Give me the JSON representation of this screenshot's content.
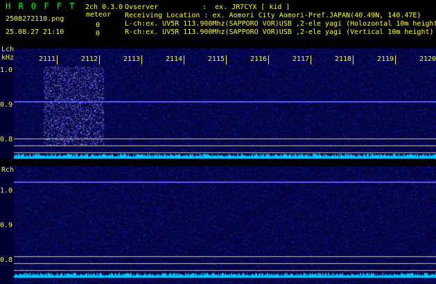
{
  "header": {
    "app_name": "H R O F F T",
    "version": "2ch 0.3.0",
    "filename": "2508272110.png",
    "mode_label": "meteor",
    "timestamp": "25.08.27 21:10",
    "count_1": "0",
    "count_2": "0",
    "observer_label": "Ovserver",
    "observer_value": ":  ex. JR7CYX [ kid ]",
    "location_line": "Receiving Location : ex. Aomori City Aomori-Pref.JAPAN(40.49N, 140.47E)",
    "lch_line": "L-ch:ex. UV5R 113.900Mhz(SAPPORO VOR)USB ,2-ele yagi (Holozontal 10m height)",
    "rch_line": "R-ch:ex. UV5R 113.900Mhz(SAPPORO VOR)USB ,2-ele yagi (Vertical 10m height)"
  },
  "lch": {
    "label": "Lch",
    "unit": "kHz",
    "ticks": [
      "1.0",
      "0.9",
      "0.8"
    ]
  },
  "rch": {
    "label": "Rch",
    "ticks": [
      "1.0",
      "0.9",
      "0.8"
    ]
  },
  "time_markers": [
    "2111",
    "2112",
    "2113",
    "2114",
    "2115",
    "2116",
    "2117",
    "2118",
    "2119",
    "2120"
  ],
  "colors": {
    "background": "#000000",
    "spectrum_base": "#000040",
    "noise": "#2020a0",
    "signal_line": "#6060ff",
    "level_trace": "#00c8ff",
    "header_green": "#00ff00",
    "header_yellow": "#ffff00"
  }
}
